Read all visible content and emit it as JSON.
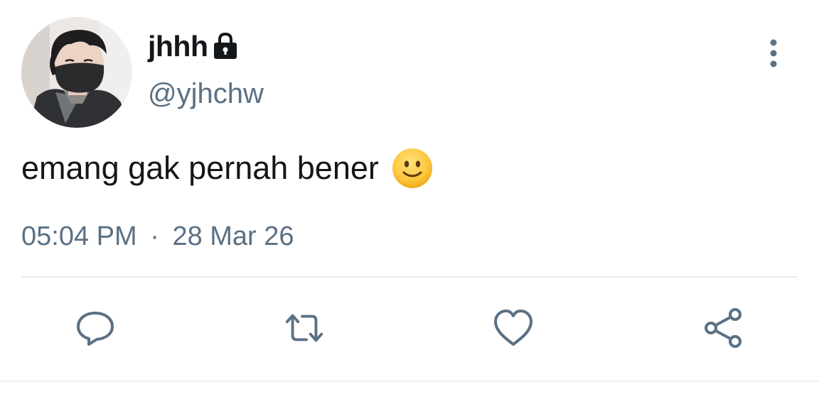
{
  "tweet": {
    "display_name": "jhhh",
    "handle": "@yjhchw",
    "text": "emang gak pernah bener",
    "emoji": "slightly-smiling-face",
    "time": "05:04 PM",
    "separator": "·",
    "date": "28 Mar 26",
    "protected": true
  },
  "icons": {
    "lock": "lock-icon",
    "more": "more-vertical-icon",
    "reply": "reply-icon",
    "retweet": "retweet-icon",
    "like": "heart-icon",
    "share": "share-icon"
  },
  "colors": {
    "text_primary": "#14171a",
    "text_secondary": "#5b7083",
    "divider": "#e6ecf0",
    "background": "#ffffff"
  }
}
